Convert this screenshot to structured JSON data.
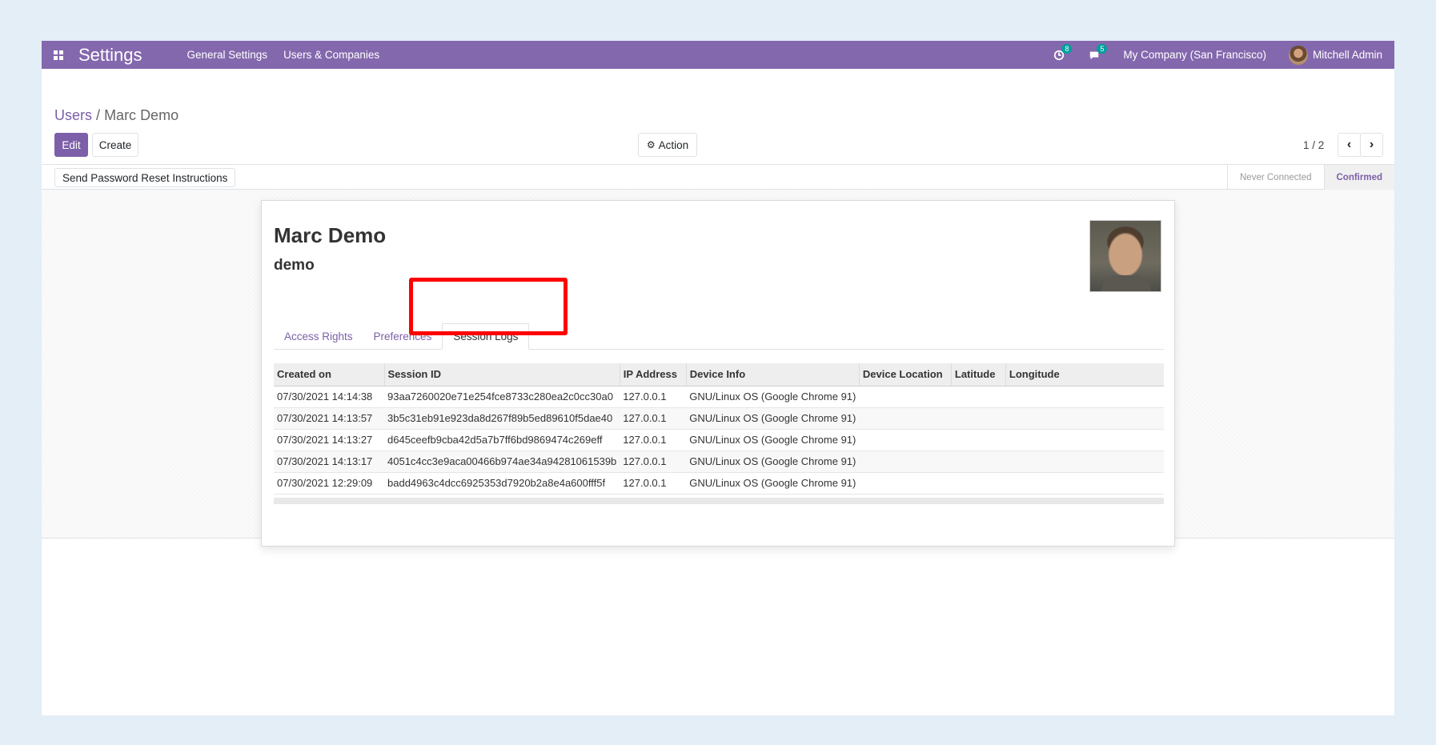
{
  "navbar": {
    "app_title": "Settings",
    "menu": [
      "General Settings",
      "Users & Companies"
    ],
    "activity_count": "8",
    "message_count": "5",
    "company": "My Company (San Francisco)",
    "user": "Mitchell Admin"
  },
  "breadcrumb": {
    "parent": "Users",
    "separator": "/",
    "current": "Marc Demo"
  },
  "buttons": {
    "edit": "Edit",
    "create": "Create",
    "action": "Action",
    "reset_password": "Send Password Reset Instructions"
  },
  "pager": {
    "value": "1 / 2"
  },
  "status": {
    "stages": [
      "Never Connected",
      "Confirmed"
    ],
    "active": "Confirmed"
  },
  "form": {
    "name": "Marc Demo",
    "login": "demo",
    "tabs": [
      "Access Rights",
      "Preferences",
      "Session Logs"
    ],
    "active_tab": "Session Logs"
  },
  "session_logs": {
    "columns": [
      "Created on",
      "Session ID",
      "IP Address",
      "Device Info",
      "Device Location",
      "Latitude",
      "Longitude"
    ],
    "rows": [
      [
        "07/30/2021 14:14:38",
        "93aa7260020e71e254fce8733c280ea2c0cc30a0",
        "127.0.0.1",
        "GNU/Linux OS (Google Chrome 91)",
        "",
        "",
        ""
      ],
      [
        "07/30/2021 14:13:57",
        "3b5c31eb91e923da8d267f89b5ed89610f5dae40",
        "127.0.0.1",
        "GNU/Linux OS (Google Chrome 91)",
        "",
        "",
        ""
      ],
      [
        "07/30/2021 14:13:27",
        "d645ceefb9cba42d5a7b7ff6bd9869474c269eff",
        "127.0.0.1",
        "GNU/Linux OS (Google Chrome 91)",
        "",
        "",
        ""
      ],
      [
        "07/30/2021 14:13:17",
        "4051c4cc3e9aca00466b974ae34a94281061539b",
        "127.0.0.1",
        "GNU/Linux OS (Google Chrome 91)",
        "",
        "",
        ""
      ],
      [
        "07/30/2021 12:29:09",
        "badd4963c4dcc6925353d7920b2a8e4a600fff5f",
        "127.0.0.1",
        "GNU/Linux OS (Google Chrome 91)",
        "",
        "",
        ""
      ]
    ]
  },
  "colors": {
    "brand": "#8468ad",
    "primary": "#7c5fa8",
    "highlight": "#ff0000"
  }
}
